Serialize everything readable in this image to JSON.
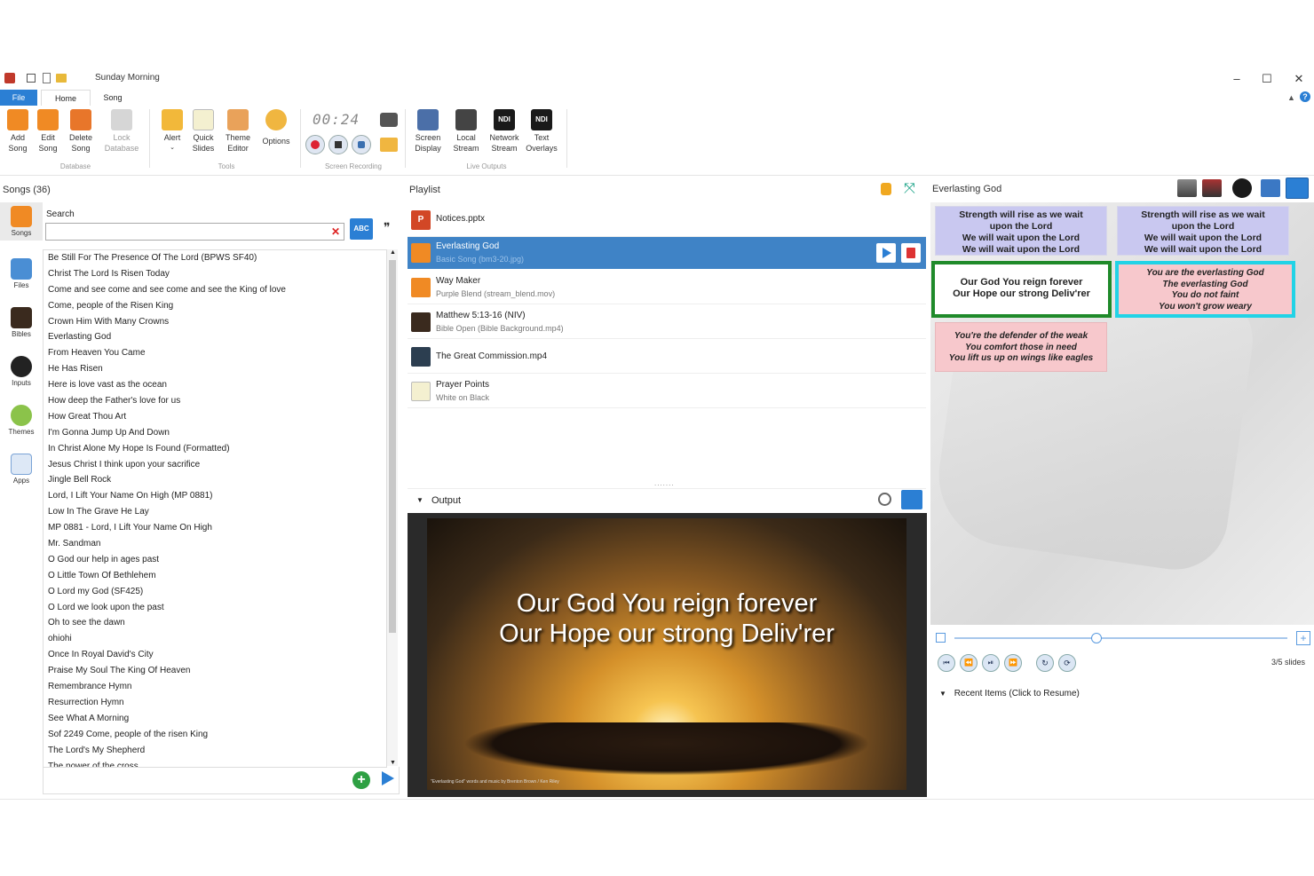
{
  "window": {
    "title": "Sunday Morning"
  },
  "tabs": [
    "File",
    "Home",
    "Song"
  ],
  "ribbon": {
    "database": {
      "group": "Database",
      "add": "Add\nSong",
      "edit": "Edit\nSong",
      "delete": "Delete\nSong",
      "lock": "Lock\nDatabase"
    },
    "tools": {
      "group": "Tools",
      "alert": "Alert",
      "quick": "Quick\nSlides",
      "theme": "Theme\nEditor",
      "options": "Options"
    },
    "recording": {
      "group": "Screen Recording",
      "timer": "00:24"
    },
    "outputs": {
      "group": "Live Outputs",
      "screen": "Screen\nDisplay",
      "local": "Local\nStream",
      "network": "Network\nStream",
      "text": "Text\nOverlays"
    }
  },
  "songs_panel": {
    "title": "Songs",
    "count": "(36)",
    "search_label": "Search",
    "abc": "ABC",
    "tabs": [
      "Songs",
      "Files",
      "Bibles",
      "Inputs",
      "Themes",
      "Apps"
    ],
    "items": [
      "Be Still For The Presence Of The Lord (BPWS SF40)",
      "Christ The Lord Is Risen Today",
      "Come and see come and see come and see the King of love",
      "Come, people of the Risen King",
      "Crown Him With Many Crowns",
      "Everlasting God",
      "From Heaven You Came",
      "He Has Risen",
      "Here is love vast as the ocean",
      "How deep the Father's love for us",
      "How Great Thou Art",
      "I'm Gonna Jump Up And Down",
      "In Christ Alone My Hope Is Found (Formatted)",
      "Jesus Christ I think upon your sacrifice",
      "Jingle Bell Rock",
      "Lord, I Lift Your Name On High (MP 0881)",
      "Low In The Grave He Lay",
      "MP 0881 - Lord, I Lift Your Name On High",
      "Mr. Sandman",
      "O God our help in ages past",
      "O Little Town Of Bethlehem",
      "O Lord my God (SF425)",
      "O Lord we look upon the past",
      "Oh to see the dawn",
      "ohiohi",
      "Once In Royal David's City",
      "Praise My Soul The King Of Heaven",
      "Remembrance Hymn",
      "Resurrection Hymn",
      "See What A Morning",
      "Sof 2249 Come, people of the risen King",
      "The Lord's My Shepherd",
      "The power of the cross"
    ]
  },
  "playlist": {
    "title": "Playlist",
    "items": [
      {
        "title": "Notices.pptx",
        "sub": ""
      },
      {
        "title": "Everlasting God",
        "sub": "Basic Song  (bm3-20.jpg)"
      },
      {
        "title": "Way Maker",
        "sub": "Purple Blend  (stream_blend.mov)"
      },
      {
        "title": "Matthew 5:13-16 (NIV)",
        "sub": "Bible Open  (Bible Background.mp4)"
      },
      {
        "title": "The Great Commission.mp4",
        "sub": ""
      },
      {
        "title": "Prayer Points",
        "sub": "White on Black"
      }
    ]
  },
  "output": {
    "title": "Output",
    "line1": "Our God You reign forever",
    "line2": "Our Hope our strong Deliv'rer",
    "credit": "\"Everlasting God\" words and music by Brenton Brown / Ken Riley"
  },
  "preview": {
    "title": "Everlasting God",
    "slides": [
      {
        "text": "Strength will rise as we wait\nupon the Lord\nWe will wait upon the Lord\nWe will wait upon the Lord",
        "color": "#c9c8f0"
      },
      {
        "text": "Strength will rise as we wait\nupon the Lord\nWe will wait upon the Lord\nWe will wait upon the Lord",
        "color": "#c9c8f0"
      },
      {
        "text": "Our God You reign forever\nOur Hope our strong Deliv'rer",
        "color": "#ffffff"
      },
      {
        "text": "You are the everlasting God\nThe everlasting God\nYou do not faint\nYou won't grow weary",
        "color": "#f7c8cc"
      },
      {
        "text": "You're the defender of the weak\nYou comfort those in need\nYou lift us up on wings like eagles",
        "color": "#f7c8cc"
      }
    ],
    "slide_count": "3/5 slides",
    "recent": "Recent Items  (Click to Resume)"
  },
  "colors": {
    "accent": "#2b7fd4",
    "selected_row": "#3f83c6",
    "live_border": "#1f8a2a",
    "next_border": "#22d3e6"
  }
}
